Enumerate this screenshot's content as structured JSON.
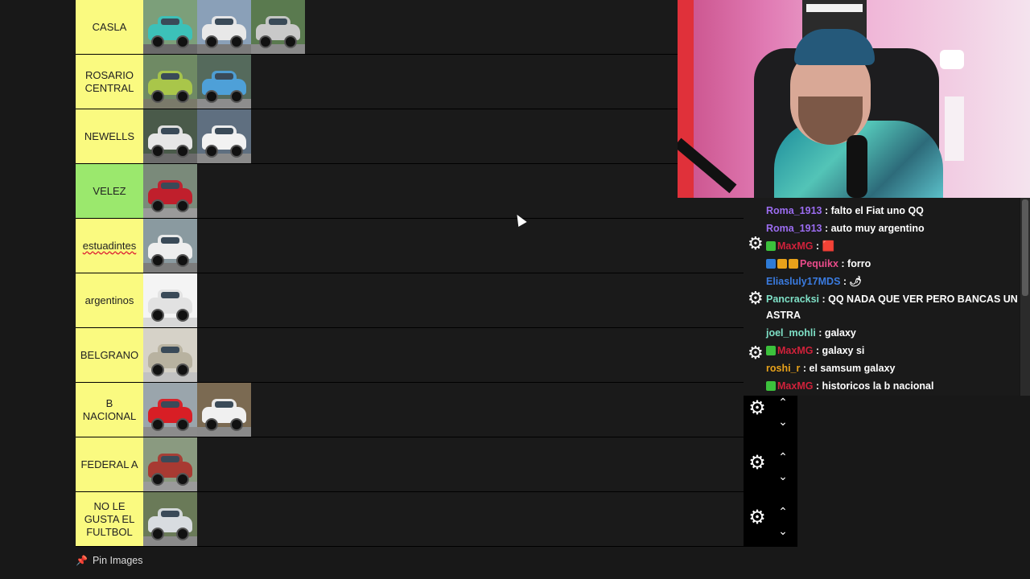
{
  "tiers": [
    {
      "label": "CASLA",
      "color": "#fafa80",
      "cars": [
        {
          "body": "#3cc1b9",
          "sky": "#7c9f7a",
          "ground": "#6a6a6a"
        },
        {
          "body": "#e8e8e8",
          "sky": "#8aa0b8",
          "ground": "#7b7b7b"
        },
        {
          "body": "#c9c9c9",
          "sky": "#5a7a4f",
          "ground": "#8a8a8a"
        }
      ]
    },
    {
      "label": "ROSARIO CENTRAL",
      "color": "#fafa80",
      "cars": [
        {
          "body": "#a9c64a",
          "sky": "#6f8a64",
          "ground": "#7a7a6a"
        },
        {
          "body": "#4ea0d8",
          "sky": "#556a5c",
          "ground": "#8d8d8d"
        }
      ]
    },
    {
      "label": "NEWELLS",
      "color": "#fafa80",
      "cars": [
        {
          "body": "#e6e6e6",
          "sky": "#4a5a4a",
          "ground": "#6b6b6b"
        },
        {
          "body": "#f2f2f2",
          "sky": "#5f6f80",
          "ground": "#8a8a8a"
        }
      ]
    },
    {
      "label": "VELEZ",
      "color": "#9be86d",
      "cars": [
        {
          "body": "#c01f2c",
          "sky": "#7a8a7a",
          "ground": "#9a9a9a"
        }
      ]
    },
    {
      "label": "estuadintes",
      "color": "#fafa80",
      "cars": [
        {
          "body": "#eeeeee",
          "sky": "#8a9aa0",
          "ground": "#7c7c7c"
        }
      ]
    },
    {
      "label": "argentinos",
      "color": "#fafa80",
      "cars": [
        {
          "body": "#e2e2e2",
          "sky": "#f4f4f4",
          "ground": "#d8d8d8"
        }
      ]
    },
    {
      "label": "BELGRANO",
      "color": "#fafa80",
      "cars": [
        {
          "body": "#b8b2a0",
          "sky": "#d6d2c8",
          "ground": "#c2c2c2"
        }
      ]
    },
    {
      "label": "B NACIONAL",
      "color": "#fafa80",
      "cars": [
        {
          "body": "#d81e25",
          "sky": "#9aa5ac",
          "ground": "#8c8c8c"
        },
        {
          "body": "#f0f0f0",
          "sky": "#7b6a52",
          "ground": "#8a8a8a"
        }
      ]
    },
    {
      "label": "FEDERAL A",
      "color": "#fafa80",
      "cars": [
        {
          "body": "#a83a32",
          "sky": "#8a9a80",
          "ground": "#9a9a9a"
        }
      ]
    },
    {
      "label": "NO LE GUSTA EL FULTBOL",
      "color": "#fafa80",
      "cars": [
        {
          "body": "#d8dce0",
          "sky": "#6a7a58",
          "ground": "#8a8a8a"
        }
      ]
    }
  ],
  "chat": [
    {
      "user": "Roma_1913",
      "user_color": "#9b6cf0",
      "badges": [],
      "text": " : falto el Fiat uno QQ"
    },
    {
      "user": "Roma_1913",
      "user_color": "#9b6cf0",
      "badges": [],
      "text": " : auto muy argentino"
    },
    {
      "user": "MaxMG",
      "user_color": "#d0213a",
      "badges": [
        "#3cc13c"
      ],
      "text": " : 🟥"
    },
    {
      "user": "Pequikx",
      "user_color": "#e94b8a",
      "badges": [
        "#2e7bd6",
        "#e8a21a",
        "#e8a21a"
      ],
      "text": " : forro"
    },
    {
      "user": "Eliasluly17MDS",
      "user_color": "#3a7be0",
      "badges": [],
      "text": " : 🌶"
    },
    {
      "user": "Pancracksi",
      "user_color": "#7ee0c6",
      "badges": [],
      "text": " : QQ NADA QUE VER PERO BANCAS UN ASTRA"
    },
    {
      "user": "joel_mohli",
      "user_color": "#7ee0c6",
      "badges": [],
      "text": " : galaxy"
    },
    {
      "user": "MaxMG",
      "user_color": "#d0213a",
      "badges": [
        "#3cc13c"
      ],
      "text": " : galaxy si"
    },
    {
      "user": "roshi_r",
      "user_color": "#e8a21a",
      "badges": [],
      "text": " : el samsum galaxy"
    },
    {
      "user": "MaxMG",
      "user_color": "#d0213a",
      "badges": [
        "#3cc13c"
      ],
      "text": " : historicos la b nacional"
    }
  ],
  "icons": {
    "gear": "gear-icon",
    "up": "chevron-up-icon",
    "down": "chevron-down-icon",
    "pin": "pin-icon"
  },
  "footer": {
    "pin_label": "Pin Images"
  }
}
